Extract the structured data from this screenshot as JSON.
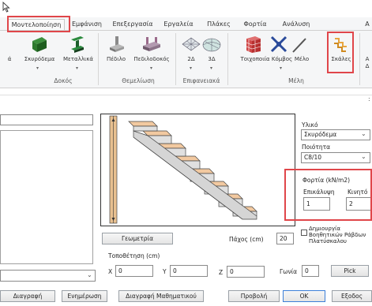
{
  "ribbon": {
    "tabs": [
      {
        "label": "Μοντελοποίηση"
      },
      {
        "label": "Εμφάνιση"
      },
      {
        "label": "Επεξεργασία"
      },
      {
        "label": "Εργαλεία"
      },
      {
        "label": "Πλάκες"
      },
      {
        "label": "Φορτία"
      },
      {
        "label": "Ανάλυση"
      },
      {
        "label": "Α"
      }
    ],
    "buttons": [
      {
        "label": "ά"
      },
      {
        "label": "Σκυρόδεμα"
      },
      {
        "label": "Μεταλλικά"
      },
      {
        "label": "Πέδιλο"
      },
      {
        "label": "Πεδιλοδοκός"
      },
      {
        "label": "2Δ"
      },
      {
        "label": "3Δ"
      },
      {
        "label": "Τοιχοποιία"
      },
      {
        "label": "Κόμβος"
      },
      {
        "label": "Μέλο"
      },
      {
        "label": "Σκάλες"
      },
      {
        "label": "Α"
      },
      {
        "label": "Δ"
      }
    ],
    "groups": [
      {
        "label": "Δοκός"
      },
      {
        "label": "Θεμελίωση"
      },
      {
        "label": "Επιφανειακά"
      },
      {
        "label": "Μέλη"
      }
    ],
    "close_mark": ":"
  },
  "dialog": {
    "material_label": "Υλικό",
    "material_value": "Σκυρόδεμα",
    "quality_label": "Ποιότητα",
    "quality_value": "C8/10",
    "loads_label": "Φορτία (kN/m2)",
    "covering_label": "Επικάλυψη",
    "covering_value": "1",
    "live_label": "Κινητό",
    "live_value": "2",
    "geometry_button": "Γεωμετρία",
    "thickness_label": "Πάχος (cm)",
    "thickness_value": "20",
    "create_label": "Δημιουργία Βοηθητικών Ράβδων Πλατύσκαλου",
    "placement_label": "Τοποθέτηση (cm)",
    "x_label": "X",
    "x_value": "0",
    "y_label": "Y",
    "y_value": "0",
    "z_label": "Z",
    "z_value": "0",
    "angle_label": "Γωνία",
    "angle_value": "0",
    "pick_button": "Pick"
  },
  "footer": {
    "delete": "Διαγραφή",
    "update": "Ενημέρωση",
    "delete_math": "Διαγραφή Μαθηματικού",
    "preview": "Προβολή",
    "ok": "OK",
    "exit": "Εξοδος"
  },
  "colors": {
    "highlight": "#e0464a",
    "ok_border": "#3c7fd8"
  }
}
